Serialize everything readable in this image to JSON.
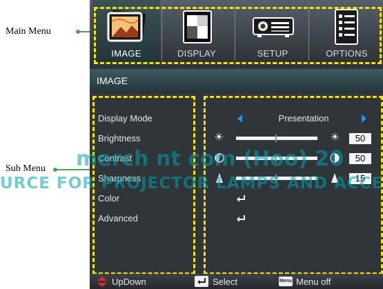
{
  "callouts": {
    "main_menu": "Main Menu",
    "sub_menu": "Sub Menu"
  },
  "tabs": [
    {
      "label": "IMAGE",
      "icon": "image-icon",
      "selected": true
    },
    {
      "label": "DISPLAY",
      "icon": "display-icon",
      "selected": false
    },
    {
      "label": "SETUP",
      "icon": "setup-icon",
      "selected": false
    },
    {
      "label": "OPTIONS",
      "icon": "options-icon",
      "selected": false
    }
  ],
  "submenu": {
    "title": "IMAGE",
    "items": [
      {
        "label": "Display Mode"
      },
      {
        "label": "Brightness"
      },
      {
        "label": "Contrast"
      },
      {
        "label": "Sharpness"
      },
      {
        "label": "Color"
      },
      {
        "label": "Advanced"
      }
    ]
  },
  "values": {
    "display_mode": "Presentation",
    "brightness": "50",
    "contrast": "50",
    "sharpness": "15"
  },
  "footer": {
    "updown": "UpDown",
    "select": "Select",
    "menu_key": "Menu",
    "menu_off": "Menu off"
  },
  "watermark": {
    "line1": "merch nt com (Hoo) 20",
    "line2": "URCE FOR PROJECTOR LAMPS AND ACCE"
  },
  "colors": {
    "highlight_dash": "#f5e400",
    "callout_line": "#4ca64c",
    "arrow_blue": "#2f8fe0",
    "updown_red": "#e0282a"
  }
}
